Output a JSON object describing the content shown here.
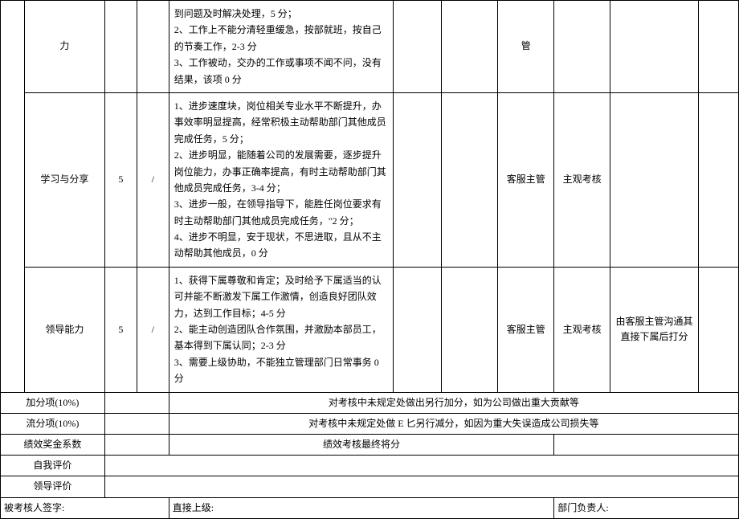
{
  "rows": {
    "r1": {
      "item": "力",
      "crit": "到问题及时解决处理，5 分；\n2、工作上不能分清轻重缓急，按部就班，按自己的节奏工作，2-3 分\n3、工作被动，交办的工作或事项不闻不问，没有结果，该项 0 分",
      "eval": "管"
    },
    "r2": {
      "item": "学习与分享",
      "weight": "5",
      "slash": "/",
      "crit": "1、进步速度块，岗位相关专业水平不断提升，办事效率明显提高，经常积极主动帮助部门其他成员完成任务，5 分；\n2、进步明显，能随着公司的发展需要，逐步提升岗位能力，办事正确率提高，有时主动帮助部门其他成员完成任务，3-4 分；\n3、进步一般，在领导指导下，能胜任岗位要求有时主动帮助部门其他成员完成任务，\"2 分；\n4、进步不明显，安于现状，不思进取，且从不主动帮助其他成员，0 分",
      "eval": "客服主管",
      "typ": "主观考核"
    },
    "r3": {
      "item": "领导能力",
      "weight": "5",
      "slash": "/",
      "crit": "1、获得下属尊敬和肯定；及时给予下属适当的认可并能不断激发下属工作激情，创造良好团队效力，达到工作目标；4-5 分\n2、能主动创造团队合作氛围，并激励本部员工，基本得到下属认同；2-3 分\n3、需要上级协助，不能独立管理部门日常事务 0 分",
      "eval": "客服主管",
      "typ": "主观考核",
      "note": "由客服主管沟通其直接下属后打分"
    }
  },
  "bottom": {
    "b1_label": "加分项(10%)",
    "b1_text": "对考核中未规定处做出另行加分，如为公司做出重大贡献等",
    "b2_label": "流分项(10%)",
    "b2_text": "对考核中未规定处做 E 匕另行减分，如因为重大失误造成公司损失等",
    "b3_label": "绩效奖金系数",
    "b3_text": "绩效考核最终将分",
    "b4_label": "自我评价",
    "b5_label": "领导评价"
  },
  "sign": {
    "s1": "被考核人签字:",
    "s2": "直接上级:",
    "s3": "部门负责人:"
  }
}
